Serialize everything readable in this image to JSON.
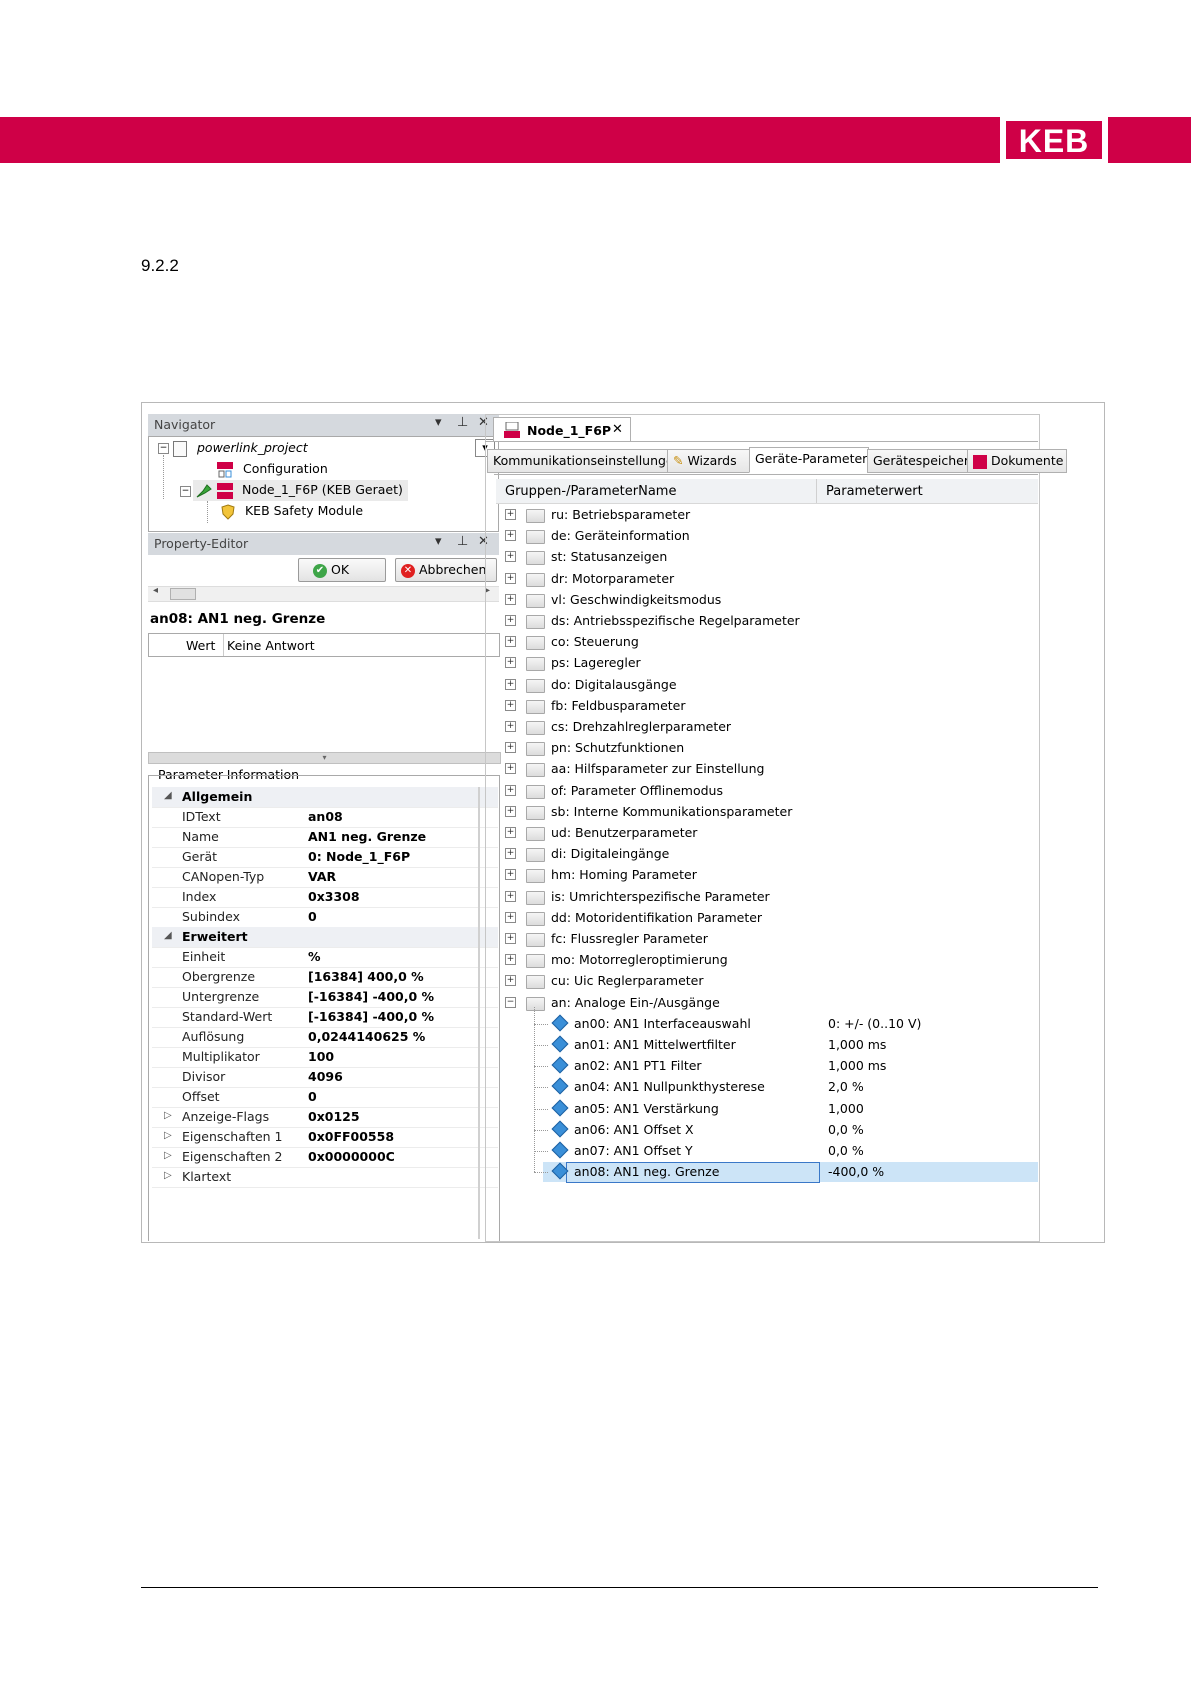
{
  "header": {
    "logo_text": "KEB",
    "brand_color": "#cf0047"
  },
  "section_number": "9.2.2",
  "navigator": {
    "title": "Navigator",
    "tree": {
      "project": "powerlink_project",
      "configuration": "Configuration",
      "node": "Node_1_F6P (KEB Geraet)",
      "safety": "KEB Safety Module"
    }
  },
  "property_editor": {
    "title": "Property-Editor",
    "ok_label": "OK",
    "cancel_label": "Abbrechen",
    "param_title": "an08: AN1 neg. Grenze",
    "value_key": "Wert",
    "value": "Keine Antwort"
  },
  "parameter_info": {
    "title": "Parameter-Information",
    "groups": [
      {
        "name": "Allgemein",
        "rows": [
          {
            "key": "IDText",
            "value": "an08"
          },
          {
            "key": "Name",
            "value": "AN1 neg. Grenze"
          },
          {
            "key": "Gerät",
            "value": "0: Node_1_F6P"
          },
          {
            "key": "CANopen-Typ",
            "value": "VAR"
          },
          {
            "key": "Index",
            "value": "0x3308"
          },
          {
            "key": "Subindex",
            "value": "0"
          }
        ]
      },
      {
        "name": "Erweitert",
        "rows": [
          {
            "key": "Einheit",
            "value": "%"
          },
          {
            "key": "Obergrenze",
            "value": "[16384] 400,0 %"
          },
          {
            "key": "Untergrenze",
            "value": "[-16384] -400,0 %"
          },
          {
            "key": "Standard-Wert",
            "value": "[-16384] -400,0 %"
          },
          {
            "key": "Auflösung",
            "value": "0,0244140625 %"
          },
          {
            "key": "Multiplikator",
            "value": "100"
          },
          {
            "key": "Divisor",
            "value": "4096"
          },
          {
            "key": "Offset",
            "value": "0"
          }
        ]
      }
    ],
    "collapsed": [
      {
        "key": "Anzeige-Flags",
        "value": "0x0125"
      },
      {
        "key": "Eigenschaften 1",
        "value": "0x0FF00558"
      },
      {
        "key": "Eigenschaften 2",
        "value": "0x0000000C"
      },
      {
        "key": "Klartext",
        "value": ""
      }
    ]
  },
  "document_tab": {
    "title": "Node_1_F6P",
    "close": "✕"
  },
  "tabs": [
    "Kommunikationseinstellungen",
    "Wizards",
    "Geräte-Parameter",
    "Gerätespeicher",
    "Dokumente"
  ],
  "grid": {
    "col_name": "Gruppen-/ParameterName",
    "col_value": "Parameterwert",
    "groups": [
      "ru: Betriebsparameter",
      "de: Geräteinformation",
      "st: Statusanzeigen",
      "dr: Motorparameter",
      "vl: Geschwindigkeitsmodus",
      "ds: Antriebsspezifische Regelparameter",
      "co: Steuerung",
      "ps: Lageregler",
      "do: Digitalausgänge",
      "fb: Feldbusparameter",
      "cs: Drehzahlreglerparameter",
      "pn: Schutzfunktionen",
      "aa: Hilfsparameter zur Einstellung",
      "of: Parameter Offlinemodus",
      "sb: Interne Kommunikationsparameter",
      "ud: Benutzerparameter",
      "di: Digitaleingänge",
      "hm: Homing Parameter",
      "is: Umrichterspezifische Parameter",
      "dd: Motoridentifikation Parameter",
      "fc: Flussregler Parameter",
      "mo: Motorregleroptimierung",
      "cu: Uic Reglerparameter"
    ],
    "expanded_group": "an: Analoge Ein-/Ausgänge",
    "params": [
      {
        "name": "an00: AN1 Interfaceauswahl",
        "value": "0: +/- (0..10 V)"
      },
      {
        "name": "an01: AN1 Mittelwertfilter",
        "value": "1,000 ms"
      },
      {
        "name": "an02: AN1 PT1 Filter",
        "value": "1,000 ms"
      },
      {
        "name": "an04: AN1 Nullpunkthysterese",
        "value": "2,0 %"
      },
      {
        "name": "an05: AN1 Verstärkung",
        "value": "1,000"
      },
      {
        "name": "an06: AN1 Offset X",
        "value": "0,0 %"
      },
      {
        "name": "an07: AN1 Offset Y",
        "value": "0,0 %"
      },
      {
        "name": "an08: AN1 neg. Grenze",
        "value": "-400,0 %"
      }
    ]
  }
}
